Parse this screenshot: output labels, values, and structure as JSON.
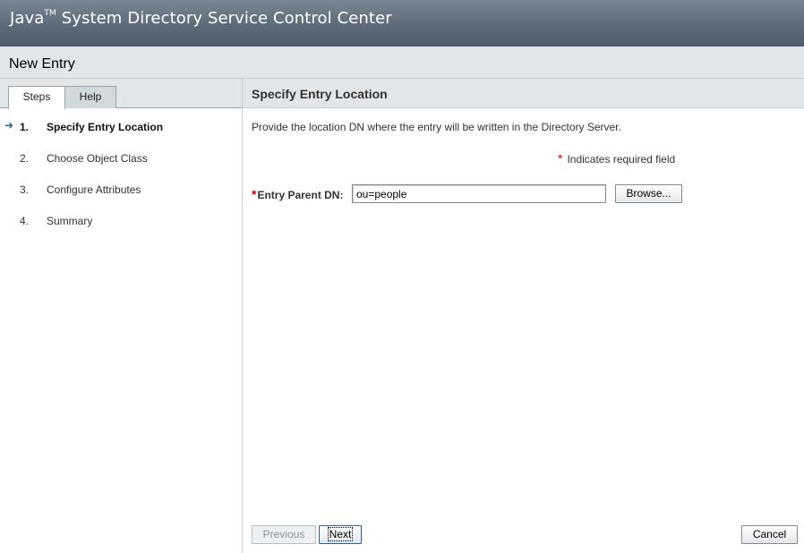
{
  "masthead": {
    "title_prefix": "Java",
    "title_tm": "TM",
    "title_rest": " System Directory Service Control Center"
  },
  "wizard": {
    "title": "New Entry"
  },
  "tabs": [
    {
      "label": "Steps",
      "active": true
    },
    {
      "label": "Help",
      "active": false
    }
  ],
  "steps": [
    {
      "number": "1.",
      "label": "Specify Entry Location",
      "current": true
    },
    {
      "number": "2.",
      "label": "Choose Object Class",
      "current": false
    },
    {
      "number": "3.",
      "label": "Configure Attributes",
      "current": false
    },
    {
      "number": "4.",
      "label": "Summary",
      "current": false
    }
  ],
  "step_page": {
    "header": "Specify Entry Location",
    "instructions": "Provide the location DN where the entry will be written in the Directory Server.",
    "required_marker": "*",
    "required_legend": "Indicates required field",
    "field_label": "Entry Parent DN:",
    "field_value": "ou=people",
    "browse_label": "Browse..."
  },
  "buttons": {
    "previous": "Previous",
    "next": "Next",
    "cancel": "Cancel"
  },
  "icons": {
    "current_step": "arrow-right-icon"
  },
  "colors": {
    "masthead": "#5d6b78",
    "required": "#cc0000",
    "current_arrow": "#2a5f9e"
  }
}
